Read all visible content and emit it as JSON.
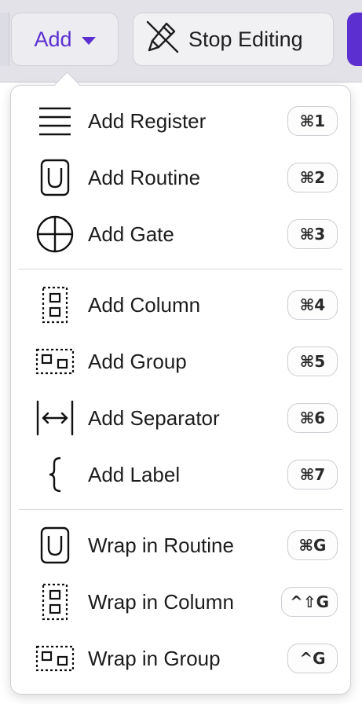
{
  "toolbar": {
    "add_label": "Add",
    "stop_editing_label": "Stop Editing"
  },
  "colors": {
    "accent": "#5b2fd0",
    "toolbar_bg": "#e2e2e8",
    "menu_bg": "#ffffff"
  },
  "menu": {
    "items": [
      {
        "label": "Add Register",
        "shortcut": "⌘1",
        "icon": "register-icon"
      },
      {
        "label": "Add Routine",
        "shortcut": "⌘2",
        "icon": "routine-icon"
      },
      {
        "label": "Add Gate",
        "shortcut": "⌘3",
        "icon": "gate-icon"
      },
      {
        "label": "Add Column",
        "shortcut": "⌘4",
        "icon": "column-icon"
      },
      {
        "label": "Add Group",
        "shortcut": "⌘5",
        "icon": "group-icon"
      },
      {
        "label": "Add Separator",
        "shortcut": "⌘6",
        "icon": "separator-icon"
      },
      {
        "label": "Add Label",
        "shortcut": "⌘7",
        "icon": "label-brace-icon"
      },
      {
        "label": "Wrap in Routine",
        "shortcut": "⌘G",
        "icon": "routine-icon"
      },
      {
        "label": "Wrap in Column",
        "shortcut": "^⇧G",
        "icon": "column-icon"
      },
      {
        "label": "Wrap in Group",
        "shortcut": "^G",
        "icon": "group-icon"
      }
    ]
  }
}
